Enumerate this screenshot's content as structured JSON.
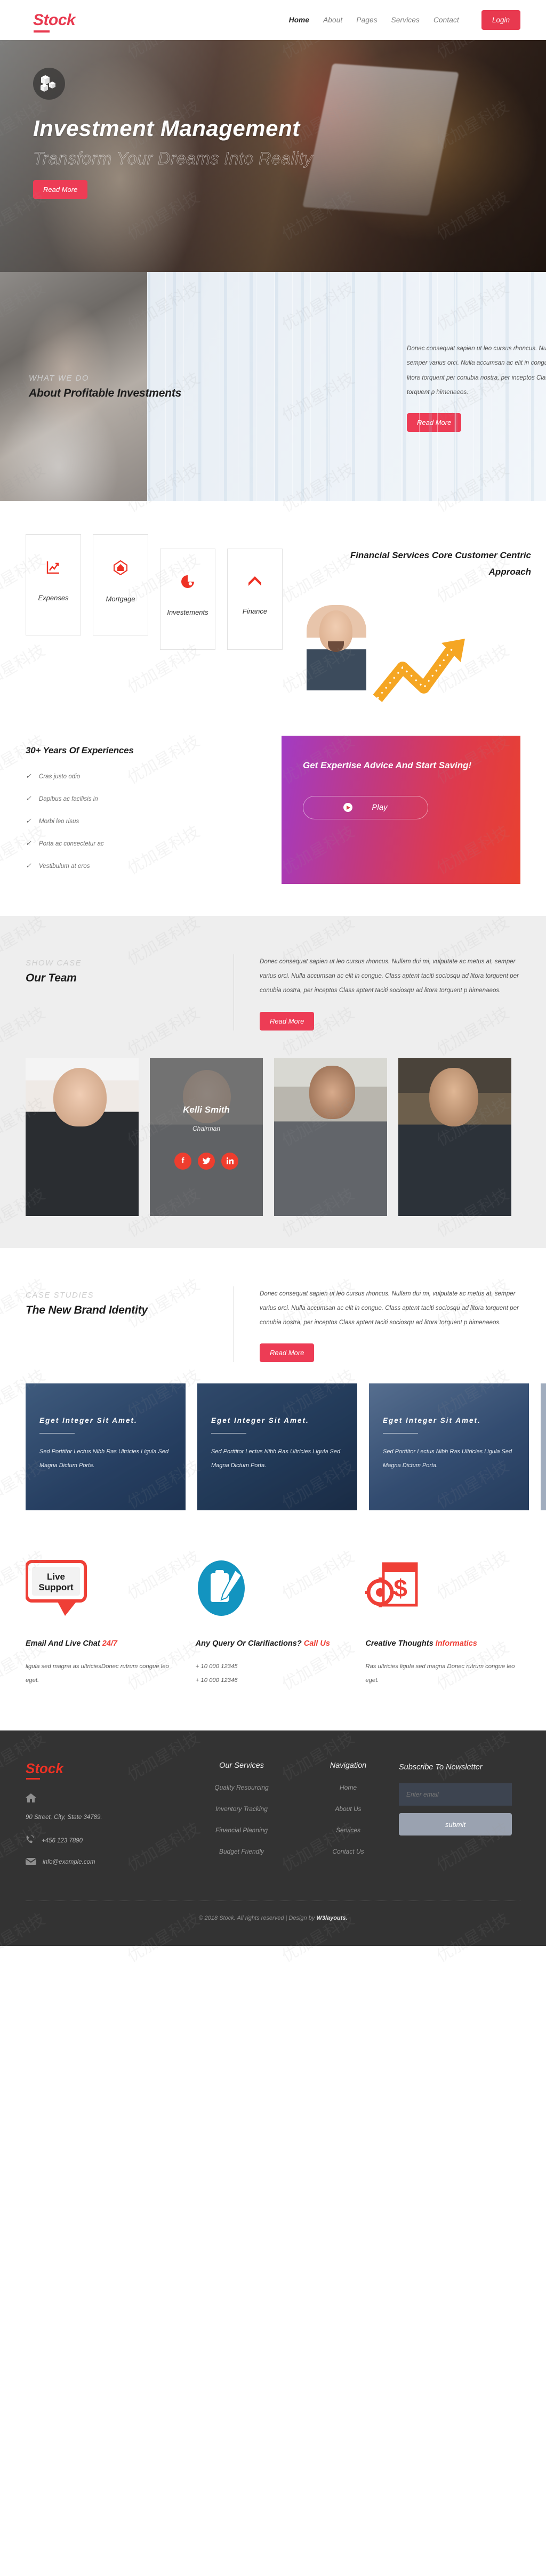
{
  "brand": {
    "name": "Stock",
    "accent": "#e8394f"
  },
  "header": {
    "nav": [
      {
        "label": "Home",
        "active": true
      },
      {
        "label": "About",
        "active": false
      },
      {
        "label": "Pages",
        "active": false
      },
      {
        "label": "Services",
        "active": false
      },
      {
        "label": "Contact",
        "active": false
      }
    ],
    "login_label": "Login"
  },
  "hero": {
    "title": "Investment  Management",
    "subtitle": "Transform Your Dreams Into Reality",
    "cta": "Read More",
    "badge_icon": "cubes-icon"
  },
  "about": {
    "eyebrow": "WHAT WE DO",
    "title": "About Profitable Investments",
    "paragraph": "Donec consequat sapien ut leo cursus rhoncus. Nullam dui mi, vulputate ac metus at, semper varius orci. Nulla accumsan ac elit in congue. Class aptent taciti sociosqu ad litora torquent per conubia nostra, per inceptos Class aptent taciti sociosqu ad litora torquent p himenaeos.",
    "cta": "Read More"
  },
  "services": {
    "heading": "Financial Services Core Customer Centric Approach",
    "cards": [
      {
        "label": "Expenses",
        "icon": "chart-line-icon"
      },
      {
        "label": "Mortgage",
        "icon": "home-shield-icon"
      },
      {
        "label": "Investements",
        "icon": "pie-chart-icon"
      },
      {
        "label": "Finance",
        "icon": "arrow-growth-icon"
      }
    ]
  },
  "experience": {
    "title": "30+ Years Of Experiences",
    "items": [
      "Cras justo odio",
      "Dapibus ac facilisis in",
      "Morbi leo risus",
      "Porta ac consectetur ac",
      "Vestibulum at eros"
    ],
    "promo_title": "Get Expertise Advice And Start Saving!",
    "play_label": "Play"
  },
  "team": {
    "eyebrow": "SHOW CASE",
    "title": "Our Team",
    "paragraph": "Donec consequat sapien ut leo cursus rhoncus. Nullam dui mi, vulputate ac metus at, semper varius orci. Nulla accumsan ac elit in congue. Class aptent taciti sociosqu ad litora torquent per conubia nostra, per inceptos Class aptent taciti sociosqu ad litora torquent p himenaeos.",
    "cta": "Read More",
    "members": [
      {
        "name": "",
        "role": "",
        "hover": false
      },
      {
        "name": "Kelli Smith",
        "role": "Chairman",
        "hover": true
      },
      {
        "name": "",
        "role": "",
        "hover": false
      },
      {
        "name": "",
        "role": "",
        "hover": false
      }
    ],
    "socials": [
      "facebook-icon",
      "twitter-icon",
      "linkedin-icon"
    ]
  },
  "cases": {
    "eyebrow": "CASE STUDIES",
    "title": "The New Brand Identity",
    "paragraph": "Donec consequat sapien ut leo cursus rhoncus. Nullam dui mi, vulputate ac metus at, semper varius orci. Nulla accumsan ac elit in congue. Class aptent taciti sociosqu ad litora torquent per conubia nostra, per inceptos Class aptent taciti sociosqu ad litora torquent p himenaeos.",
    "cta": "Read More",
    "cards": [
      {
        "title": "Eget  Integer  Sit  Amet.",
        "text": "Sed Porttitor Lectus Nibh Ras Ultricies Ligula Sed Magna Dictum Porta."
      },
      {
        "title": "Eget  Integer  Sit  Amet.",
        "text": "Sed Porttitor Lectus Nibh Ras Ultricies Ligula Sed Magna Dictum Porta."
      },
      {
        "title": "Eget  Integer  Sit  Amet.",
        "text": "Sed Porttitor Lectus Nibh Ras Ultricies Ligula Sed Magna Dictum Porta."
      },
      {
        "title": "",
        "text": ""
      }
    ]
  },
  "features": [
    {
      "icon": "live-support-chat-icon",
      "icon_text_1": "Live",
      "icon_text_2": "Support",
      "title": "Email And Live Chat ",
      "title_hl": "24/7",
      "text": "ligula sed magna as ultriciesDonec rutrum congue leo eget."
    },
    {
      "icon": "clipboard-pencil-icon",
      "title": "Any Query Or Clarifiactions? ",
      "title_hl": "Call Us",
      "phone1": "+ 10 000 12345",
      "phone2": "+ 10 000 12346"
    },
    {
      "icon": "gear-dollar-icon",
      "title": "Creative Thoughts ",
      "title_hl": "Informatics",
      "text": "Ras ultricies ligula sed magna Donec rutrum congue leo eget."
    }
  ],
  "footer": {
    "logo": "Stock",
    "address": "90 Street, City, State 34789.",
    "phone": "+456 123 7890",
    "email": "info@example.com",
    "services_head": "Our Services",
    "services": [
      "Quality Resourcing",
      "Inventory Tracking",
      "Financial Planning",
      "Budget Friendly"
    ],
    "nav_head": "Navigation",
    "nav": [
      "Home",
      "About Us",
      "Services",
      "Contact Us"
    ],
    "subscribe_head": "Subscribe To Newsletter",
    "email_placeholder": "Enter email",
    "email_value": "",
    "submit_label": "submit",
    "copyright_pre": "© 2018 Stock. All rights reserved | Design by ",
    "copyright_brand": "W3layouts."
  }
}
